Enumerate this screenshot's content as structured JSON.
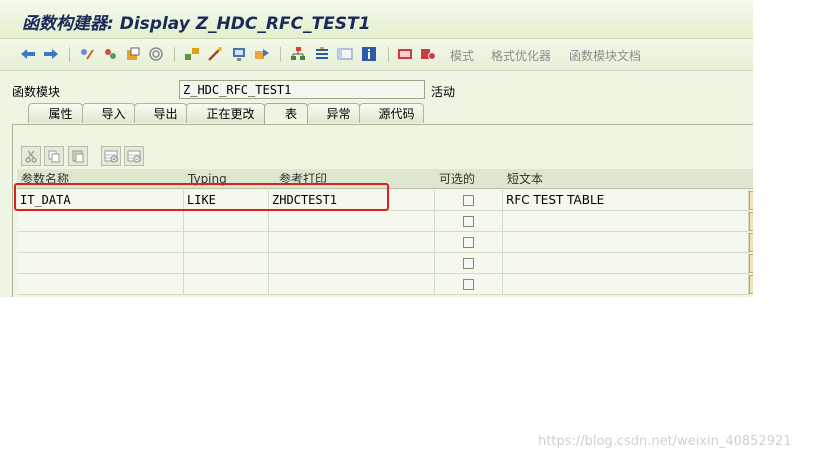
{
  "window": {
    "title": "函数构建器:  Display Z_HDC_RFC_TEST1"
  },
  "toolbar": {
    "text_buttons": [
      "模式",
      "格式优化器",
      "函数模块文档"
    ]
  },
  "header": {
    "function_module_label": "函数模块",
    "function_module_value": "Z_HDC_RFC_TEST1",
    "status": "活动"
  },
  "tabs": [
    {
      "label": "属性"
    },
    {
      "label": "导入"
    },
    {
      "label": "导出"
    },
    {
      "label": "正在更改"
    },
    {
      "label": "表"
    },
    {
      "label": "异常"
    },
    {
      "label": "源代码"
    }
  ],
  "active_tab": "表",
  "table": {
    "columns": [
      "参数名称",
      "Typing",
      "参考打印",
      "可选的",
      "短文本"
    ],
    "rows": [
      {
        "param": "IT_DATA",
        "typing": "LIKE",
        "ref": "ZHDCTEST1",
        "optional": false,
        "text": "RFC TEST TABLE"
      },
      {
        "param": "",
        "typing": "",
        "ref": "",
        "optional": false,
        "text": ""
      },
      {
        "param": "",
        "typing": "",
        "ref": "",
        "optional": false,
        "text": ""
      },
      {
        "param": "",
        "typing": "",
        "ref": "",
        "optional": false,
        "text": ""
      },
      {
        "param": "",
        "typing": "",
        "ref": "",
        "optional": false,
        "text": ""
      }
    ]
  },
  "watermark": "https://blog.csdn.net/weixin_40852921",
  "colors": {
    "background": "#eef5e3",
    "highlight_box": "#e02020",
    "title_text": "#1b2a5a"
  }
}
